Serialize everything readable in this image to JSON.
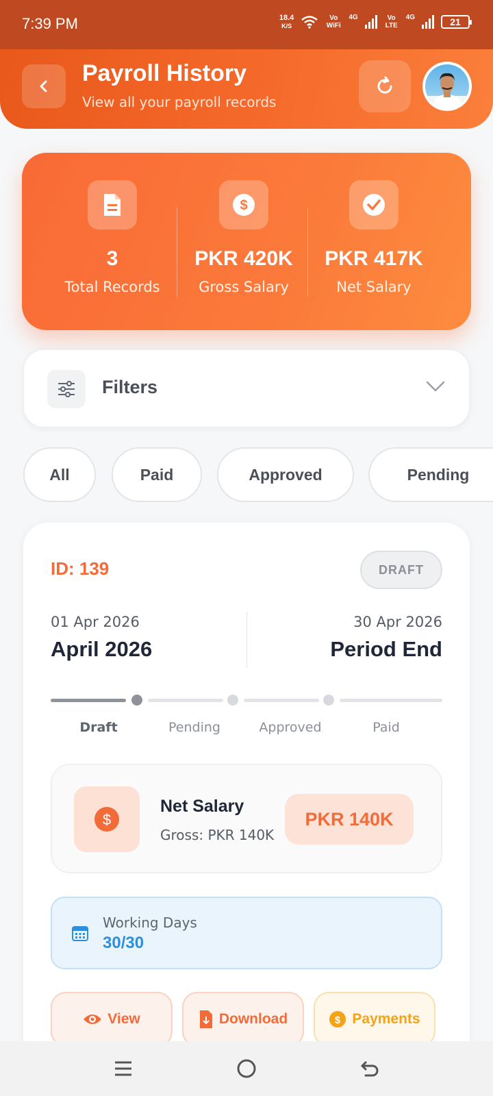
{
  "status_bar": {
    "time": "7:39 PM",
    "speed_value": "18.4",
    "speed_unit": "K/S",
    "wifi_tag": "Vo WiFi",
    "net1": "4G",
    "lte_tag": "Vo LTE",
    "net2": "4G",
    "battery": "21"
  },
  "header": {
    "title": "Payroll History",
    "subtitle": "View all your payroll records",
    "back_icon": "chevron-left-icon",
    "refresh_icon": "refresh-icon"
  },
  "summary": {
    "items": [
      {
        "value": "3",
        "label": "Total Records",
        "icon": "document-icon"
      },
      {
        "value": "PKR 420K",
        "label": "Gross Salary",
        "icon": "dollar-icon"
      },
      {
        "value": "PKR 417K",
        "label": "Net Salary",
        "icon": "check-icon"
      }
    ]
  },
  "filters": {
    "label": "Filters",
    "chips": [
      "All",
      "Paid",
      "Approved",
      "Pending"
    ]
  },
  "record": {
    "id": "ID: 139",
    "status": "DRAFT",
    "period_start_date": "01 Apr 2026",
    "period_start_label": "April 2026",
    "period_end_date": "30 Apr 2026",
    "period_end_label": "Period End",
    "steps": [
      "Draft",
      "Pending",
      "Approved",
      "Paid"
    ],
    "current_step": 0,
    "net_title": "Net Salary",
    "gross_text": "Gross: PKR 140K",
    "net_amount": "PKR 140K",
    "working_days_label": "Working Days",
    "working_days_value": "30/30",
    "actions": [
      "View",
      "Download",
      "Payments"
    ]
  },
  "colors": {
    "accent": "#F26B38",
    "info": "#2E8FDC",
    "payments": "#F5A316"
  }
}
